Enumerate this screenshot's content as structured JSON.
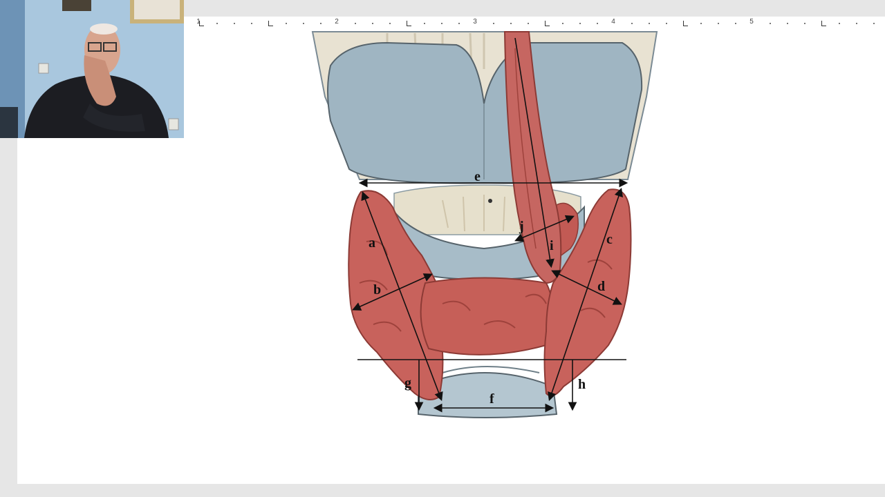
{
  "ruler": {
    "numbers": [
      "1",
      "2",
      "3",
      "4",
      "5"
    ]
  },
  "figure": {
    "labels": {
      "a": "a",
      "b": "b",
      "c": "c",
      "d": "d",
      "e": "e",
      "f": "f",
      "g": "g",
      "h": "h",
      "i": "i",
      "j": "j"
    }
  },
  "colors": {
    "cartilage": "#9fb5c2",
    "gland": "#c8625c",
    "page": "#ffffff",
    "frame": "#e6e6e6"
  }
}
